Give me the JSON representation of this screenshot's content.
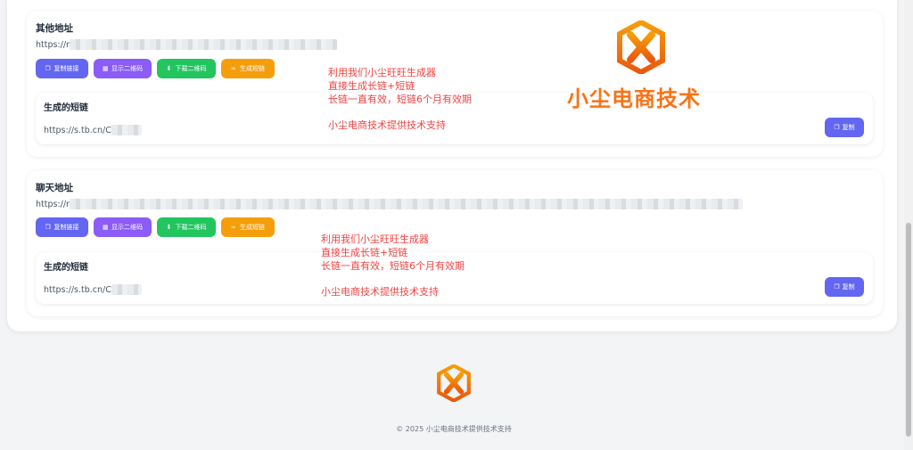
{
  "sections": [
    {
      "title": "其他地址",
      "url_prefix": "https://r",
      "buttons": {
        "copy": "复制链接",
        "qr": "显示二维码",
        "download": "下载二维码",
        "generate": "生成短链"
      },
      "short_title": "生成的短链",
      "short_url": "https://s.tb.cn/C",
      "copy_label": "复制"
    },
    {
      "title": "聊天地址",
      "url_prefix": "https://r",
      "buttons": {
        "copy": "复制链接",
        "qr": "显示二维码",
        "download": "下载二维码",
        "generate": "生成短链"
      },
      "short_title": "生成的短链",
      "short_url": "https://s.tb.cn/C",
      "copy_label": "复制"
    }
  ],
  "promo": {
    "line1": "利用我们小尘旺旺生成器",
    "line2": "直接生成长链+短链",
    "line3": "长链一直有效，短链6个月有效期",
    "line4": "小尘电商技术提供技术支持"
  },
  "brand": {
    "name": "小尘电商技术",
    "color": "#f97316"
  },
  "footer": {
    "text": "© 2025 小尘电商技术提供技术支持"
  },
  "colors": {
    "copy": "#6366f1",
    "qr": "#8b5cf6",
    "download": "#22c55e",
    "generate": "#f59e0b",
    "promo": "#ef4444"
  }
}
